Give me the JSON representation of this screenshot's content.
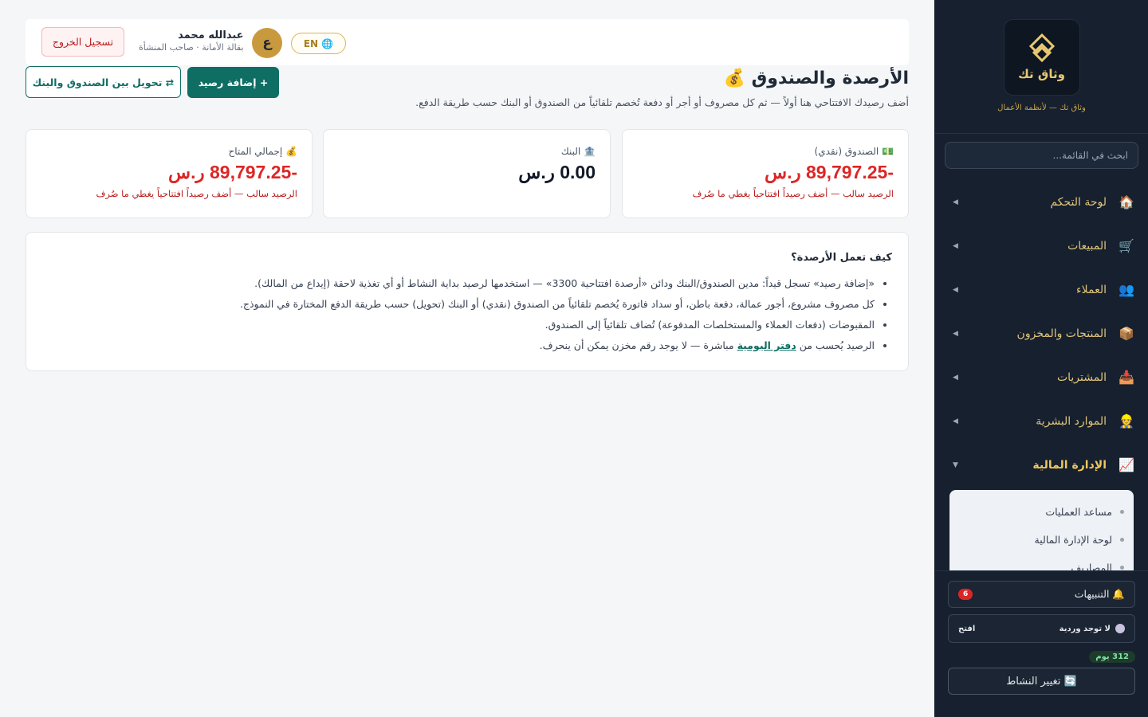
{
  "brand": {
    "name": "وثاق تك",
    "tagline": "وثاق تك — لأنظمة الأعمال"
  },
  "sidebar": {
    "search_placeholder": "ابحث في القائمة...",
    "items": [
      {
        "label": "لوحة التحكم",
        "icon": "🏠"
      },
      {
        "label": "المبيعات",
        "icon": "🛒"
      },
      {
        "label": "العملاء",
        "icon": "👥"
      },
      {
        "label": "المنتجات والمخزون",
        "icon": "📦"
      },
      {
        "label": "المشتريات",
        "icon": "📥"
      },
      {
        "label": "الموارد البشرية",
        "icon": "👷"
      },
      {
        "label": "الإدارة المالية",
        "icon": "📈"
      }
    ],
    "subitems": [
      {
        "label": "مساعد العمليات"
      },
      {
        "label": "لوحة الإدارة المالية"
      },
      {
        "label": "المصاريف"
      }
    ],
    "caret_collapsed": "◀",
    "caret_expanded": "▼",
    "notifications_label": "🔔 التنبيهات",
    "notifications_count": "6",
    "shift_status": "لا توجد وردية",
    "shift_open": "افتح",
    "days_left": "312 يوم",
    "change_activity": "🔄 تغيير النشاط"
  },
  "topbar": {
    "logout": "تسجيل الخروج",
    "user_name": "عبدالله محمد",
    "user_role": "بقالة الأمانة · صاحب المنشأة",
    "avatar_letter": "ع",
    "lang": "🌐 EN"
  },
  "page": {
    "title": "الأرصدة والصندوق 💰",
    "subtitle": "أضف رصيدك الافتتاحي هنا أولاً — ثم كل مصروف أو أجر أو دفعة تُخصم تلقائياً من الصندوق أو البنك حسب طريقة الدفع.",
    "add_balance": "+ إضافة رصيد",
    "transfer": "⇄ تحويل بين الصندوق والبنك"
  },
  "cards": [
    {
      "label": "💵 الصندوق (نقدي)",
      "value": "-89,797.25 ر.س",
      "note": "الرصيد سالب — أضف رصيداً افتتاحياً يغطي ما صُرف"
    },
    {
      "label": "🏦 البنك",
      "value": "0.00 ر.س",
      "note": ""
    },
    {
      "label": "💰 إجمالي المتاح",
      "value": "-89,797.25 ر.س",
      "note": "الرصيد سالب — أضف رصيداً افتتاحياً يغطي ما صُرف"
    }
  ],
  "info": {
    "title": "كيف تعمل الأرصدة؟",
    "points": [
      "«إضافة رصيد» تسجل قيداً: مدين الصندوق/البنك ودائن «أرصدة افتتاحية 3300» — استخدمها لرصيد بداية النشاط أو أي تغذية لاحقة (إيداع من المالك).",
      "كل مصروف مشروع، أجور عمالة، دفعة باطن، أو سداد فاتورة يُخصم تلقائياً من الصندوق (نقدي) أو البنك (تحويل) حسب طريقة الدفع المختارة في النموذج.",
      "المقبوضات (دفعات العملاء والمستخلصات المدفوعة) تُضاف تلقائياً إلى الصندوق."
    ],
    "last_point_before": "الرصيد يُحسب من",
    "last_point_link": "دفتر اليومية",
    "last_point_after": "مباشرة — لا يوجد رقم مخزن يمكن أن ينحرف."
  }
}
